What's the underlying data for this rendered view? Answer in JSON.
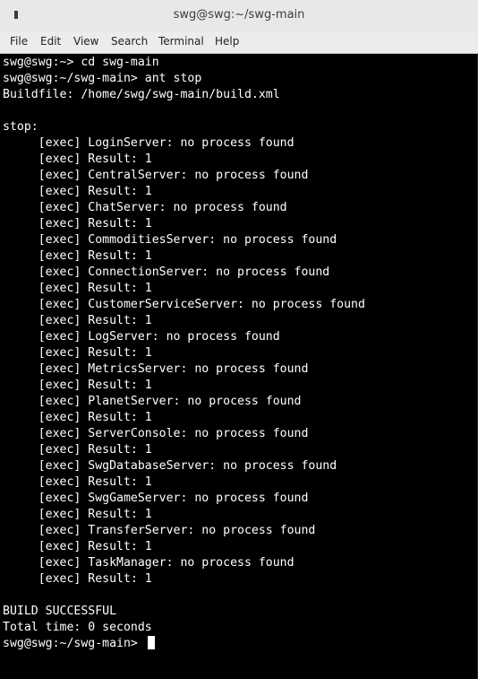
{
  "window": {
    "title": "swg@swg:~/swg-main"
  },
  "menubar": {
    "items": [
      "File",
      "Edit",
      "View",
      "Search",
      "Terminal",
      "Help"
    ]
  },
  "terminal": {
    "lines": [
      "swg@swg:~> cd swg-main",
      "swg@swg:~/swg-main> ant stop",
      "Buildfile: /home/swg/swg-main/build.xml",
      "",
      "stop:",
      "     [exec] LoginServer: no process found",
      "     [exec] Result: 1",
      "     [exec] CentralServer: no process found",
      "     [exec] Result: 1",
      "     [exec] ChatServer: no process found",
      "     [exec] Result: 1",
      "     [exec] CommoditiesServer: no process found",
      "     [exec] Result: 1",
      "     [exec] ConnectionServer: no process found",
      "     [exec] Result: 1",
      "     [exec] CustomerServiceServer: no process found",
      "     [exec] Result: 1",
      "     [exec] LogServer: no process found",
      "     [exec] Result: 1",
      "     [exec] MetricsServer: no process found",
      "     [exec] Result: 1",
      "     [exec] PlanetServer: no process found",
      "     [exec] Result: 1",
      "     [exec] ServerConsole: no process found",
      "     [exec] Result: 1",
      "     [exec] SwgDatabaseServer: no process found",
      "     [exec] Result: 1",
      "     [exec] SwgGameServer: no process found",
      "     [exec] Result: 1",
      "     [exec] TransferServer: no process found",
      "     [exec] Result: 1",
      "     [exec] TaskManager: no process found",
      "     [exec] Result: 1",
      "",
      "BUILD SUCCESSFUL",
      "Total time: 0 seconds"
    ],
    "prompt": "swg@swg:~/swg-main> ",
    "colors": {
      "background": "#000000",
      "foreground": "#ffffff"
    }
  }
}
